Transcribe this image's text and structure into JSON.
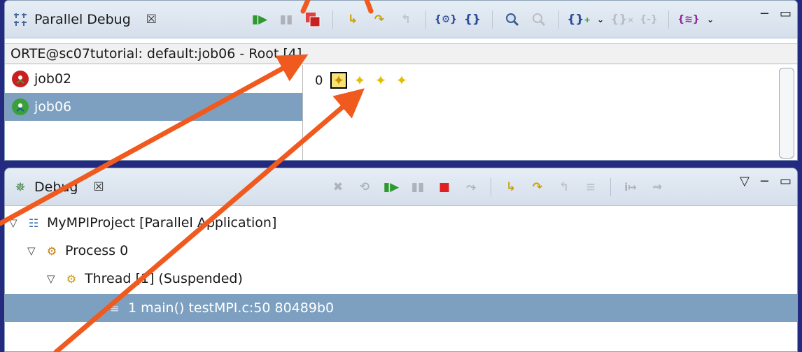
{
  "parallel_debug": {
    "tab_title": "Parallel Debug",
    "tab_close": "☒",
    "info": "ORTE@sc07tutorial: default:job06 - Root [4]",
    "jobs": [
      {
        "label": "job02",
        "selected": false
      },
      {
        "label": "job06",
        "selected": true
      }
    ],
    "rank_label": "0",
    "processes": [
      {
        "glyph": "✦",
        "selected": true
      },
      {
        "glyph": "✦",
        "selected": false
      },
      {
        "glyph": "✦",
        "selected": false
      },
      {
        "glyph": "✦",
        "selected": false
      }
    ],
    "window_controls": {
      "minimize": "−",
      "maximize": "▭"
    }
  },
  "debug": {
    "tab_title": "Debug",
    "tab_close": "☒",
    "tree": {
      "project": "MyMPIProject [Parallel Application]",
      "process": "Process 0",
      "thread": "Thread [1] (Suspended)",
      "frame": "1 main() testMPI.c:50 80489b0"
    },
    "window_controls": {
      "menu": "▽",
      "minimize": "−",
      "maximize": "▭"
    }
  },
  "colors": {
    "background": "#242a80",
    "selection": "#7ea0c0",
    "annotation_arrow": "#f05a1e"
  }
}
